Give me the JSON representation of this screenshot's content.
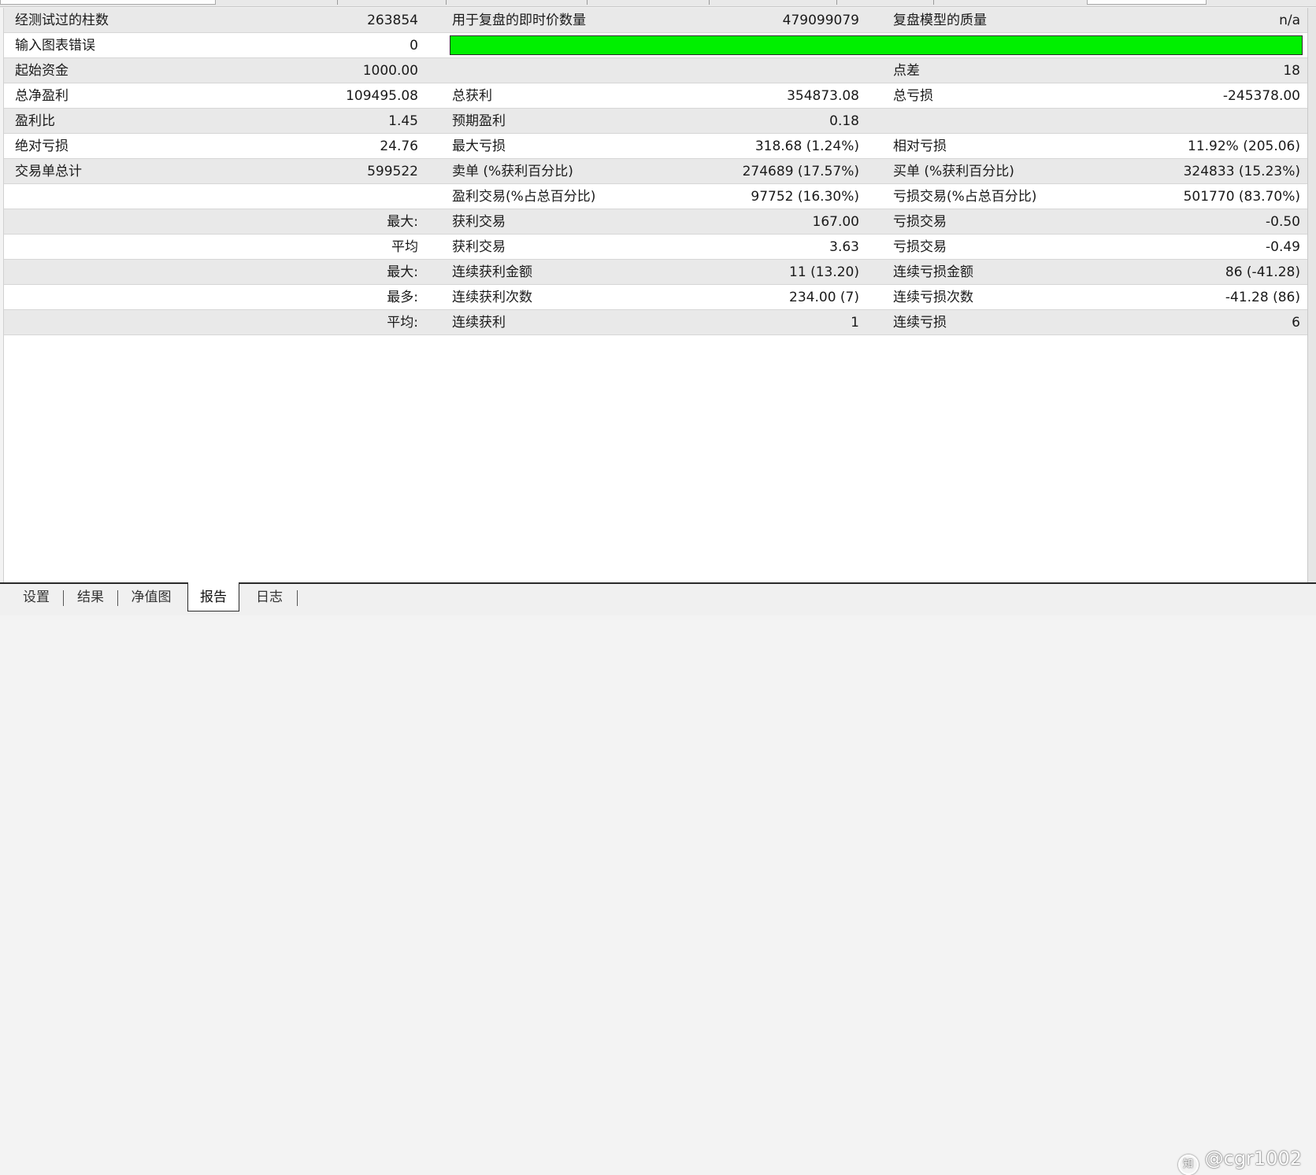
{
  "rows": [
    {
      "l1": "经测试过的柱数",
      "v1": "263854",
      "l2": "用于复盘的即时价数量",
      "v2": "479099079",
      "l3": "复盘模型的质量",
      "v3": "n/a"
    },
    {
      "l1": "输入图表错误",
      "v1": "0",
      "l2": "",
      "v2": "",
      "l3": "",
      "v3": ""
    },
    {
      "l1": "起始资金",
      "v1": "1000.00",
      "l2": "",
      "v2": "",
      "l3": "点差",
      "v3": "18"
    },
    {
      "l1": "总净盈利",
      "v1": "109495.08",
      "l2": "总获利",
      "v2": "354873.08",
      "l3": "总亏损",
      "v3": "-245378.00"
    },
    {
      "l1": "盈利比",
      "v1": "1.45",
      "l2": "预期盈利",
      "v2": "0.18",
      "l3": "",
      "v3": ""
    },
    {
      "l1": "绝对亏损",
      "v1": "24.76",
      "l2": "最大亏损",
      "v2": "318.68 (1.24%)",
      "l3": "相对亏损",
      "v3": "11.92% (205.06)"
    },
    {
      "l1": "交易单总计",
      "v1": "599522",
      "l2": "卖单 (%获利百分比)",
      "v2": "274689 (17.57%)",
      "l3": "买单 (%获利百分比)",
      "v3": "324833 (15.23%)"
    },
    {
      "l1": "",
      "v1": "",
      "l2": "盈利交易(%占总百分比)",
      "v2": "97752 (16.30%)",
      "l3": "亏损交易(%占总百分比)",
      "v3": "501770 (83.70%)"
    },
    {
      "l1": "",
      "v1": "最大:",
      "l2": "获利交易",
      "v2": "167.00",
      "l3": "亏损交易",
      "v3": "-0.50"
    },
    {
      "l1": "",
      "v1": "平均",
      "l2": "获利交易",
      "v2": "3.63",
      "l3": "亏损交易",
      "v3": "-0.49"
    },
    {
      "l1": "",
      "v1": "最大:",
      "l2": "连续获利金额",
      "v2": "11 (13.20)",
      "l3": "连续亏损金额",
      "v3": "86 (-41.28)"
    },
    {
      "l1": "",
      "v1": "最多:",
      "l2": "连续获利次数",
      "v2": "234.00 (7)",
      "l3": "连续亏损次数",
      "v3": "-41.28 (86)"
    },
    {
      "l1": "",
      "v1": "平均:",
      "l2": "连续获利",
      "v2": "1",
      "l3": "连续亏损",
      "v3": "6"
    }
  ],
  "quality_bar": {
    "color": "#00f000"
  },
  "tabs": [
    "设置",
    "结果",
    "净值图",
    "报告",
    "日志"
  ],
  "active_tab": "报告",
  "watermark": "@cgr1002",
  "colors": {
    "row_shade": "#e9e9e9",
    "row_plain": "#ffffff"
  }
}
